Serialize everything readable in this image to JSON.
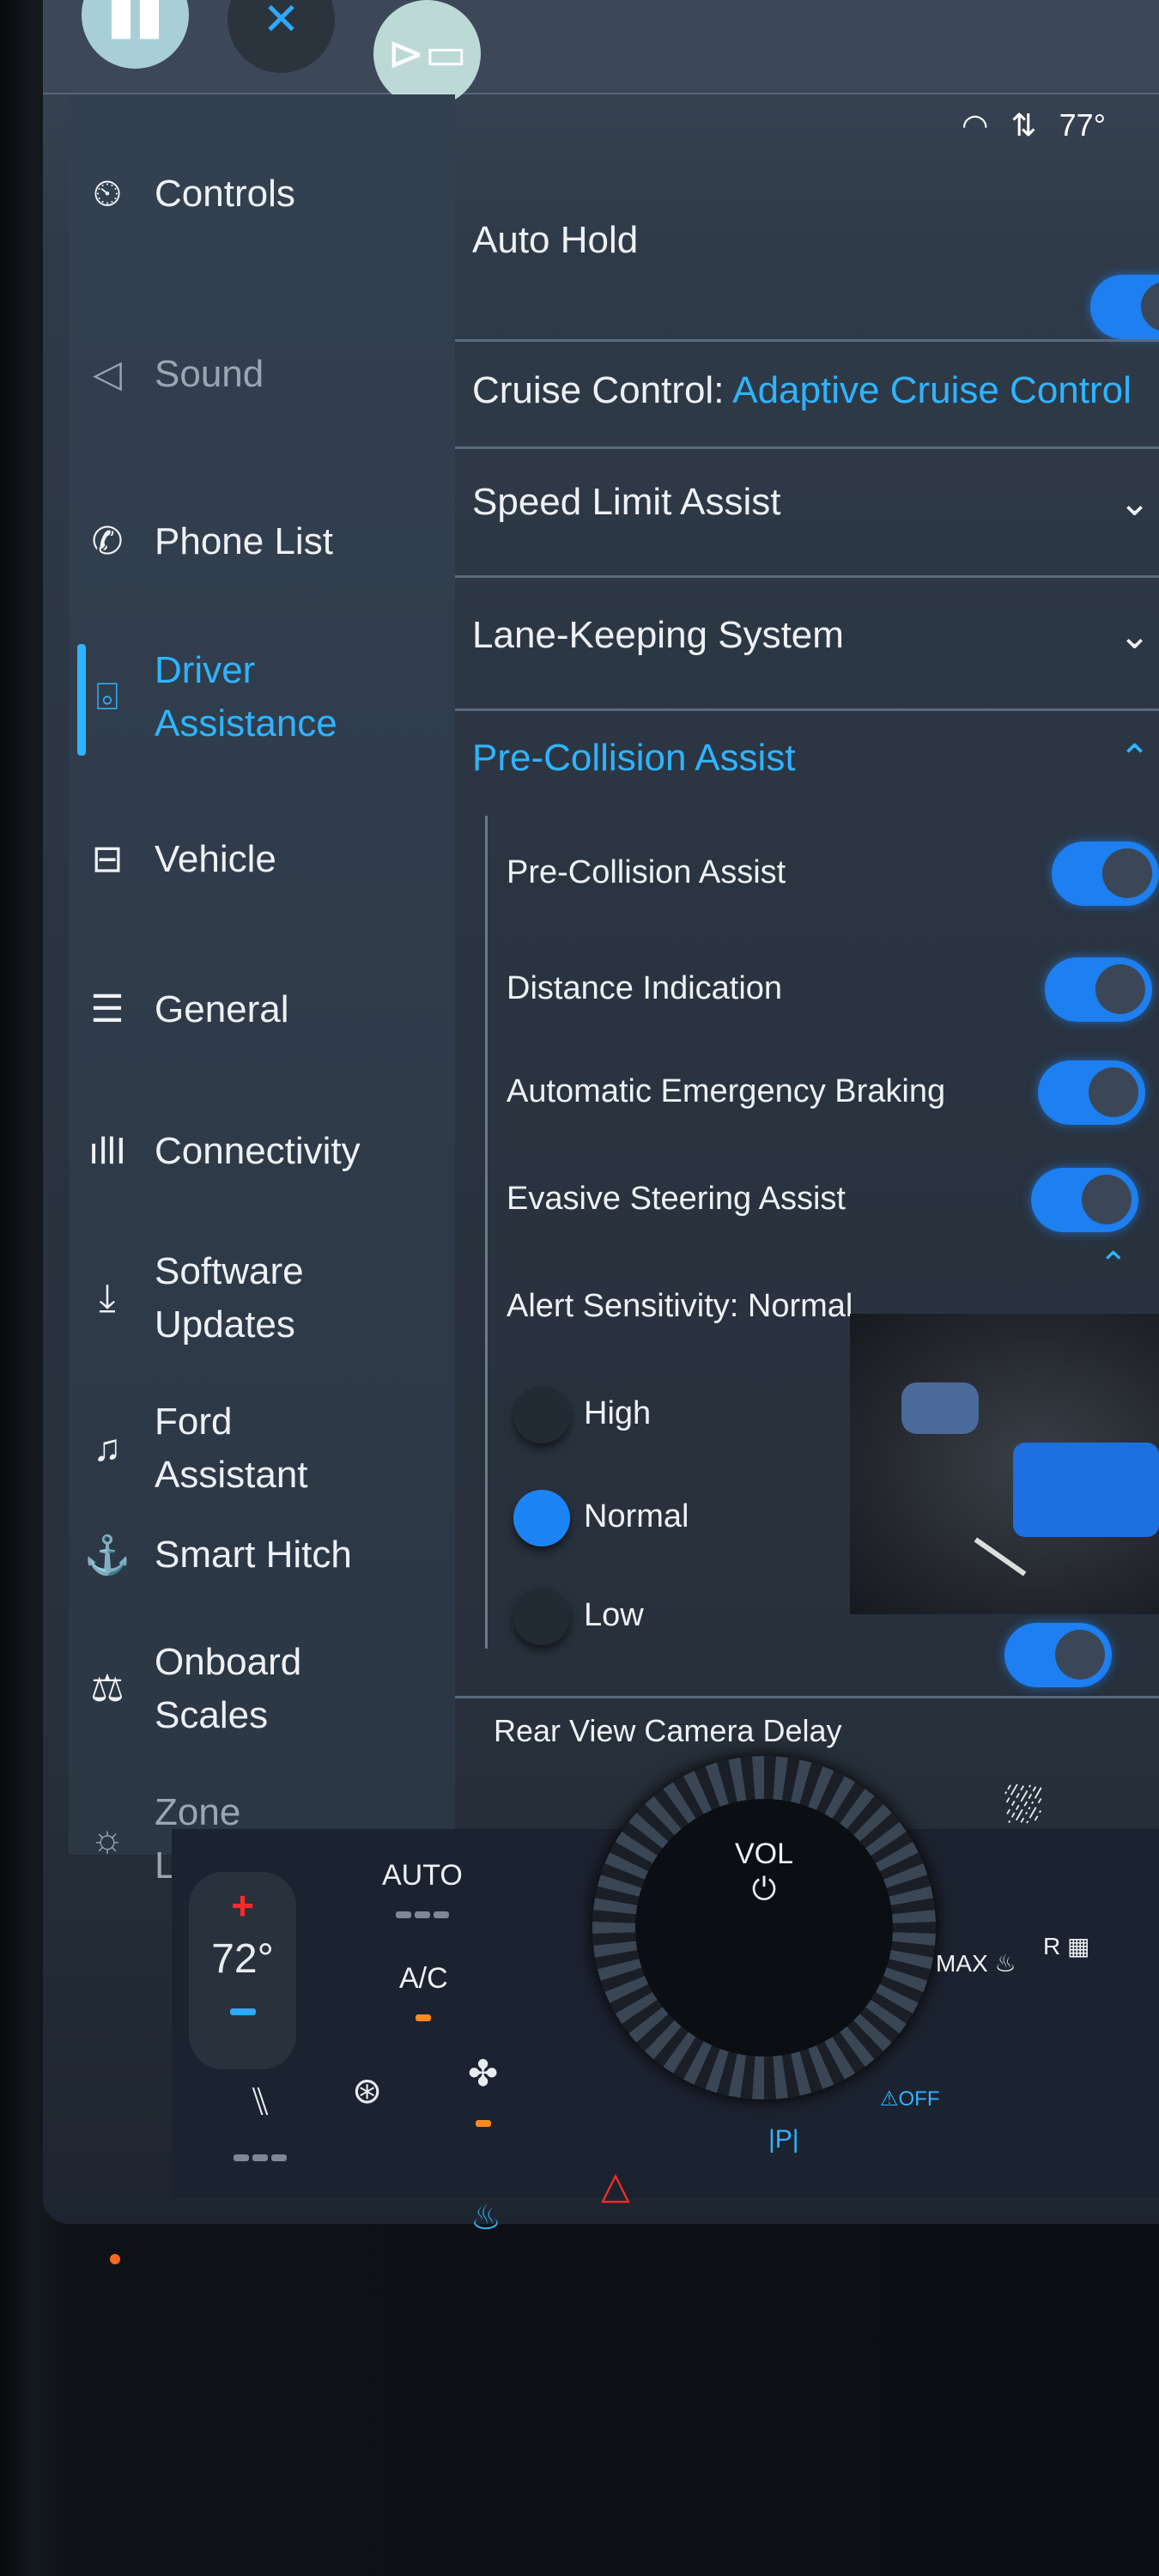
{
  "status": {
    "temperature": "77°",
    "icons": [
      "wifi-icon",
      "data-arrows-icon"
    ]
  },
  "topbar": {
    "buttons": [
      "home-icon",
      "close-icon",
      "camera-icon"
    ],
    "close_glyph": "✕"
  },
  "sidebar": {
    "items": [
      {
        "label": "Controls",
        "icon": "controls-icon",
        "glyph": "⏲"
      },
      {
        "label": "Sound",
        "icon": "speaker-icon",
        "glyph": "◁"
      },
      {
        "label": "Phone List",
        "icon": "phone-icon",
        "glyph": "✆"
      },
      {
        "label": "Driver Assistance",
        "icon": "driver-assist-icon",
        "glyph": "⌻",
        "active": true
      },
      {
        "label": "Vehicle",
        "icon": "vehicle-icon",
        "glyph": "⊟"
      },
      {
        "label": "General",
        "icon": "sliders-icon",
        "glyph": "☰"
      },
      {
        "label": "Connectivity",
        "icon": "signal-icon",
        "glyph": "ıllI"
      },
      {
        "label": "Software Updates",
        "icon": "download-icon",
        "glyph": "⤓"
      },
      {
        "label": "Ford Assistant",
        "icon": "assistant-icon",
        "glyph": "♫"
      },
      {
        "label": "Smart Hitch",
        "icon": "hitch-icon",
        "glyph": "⚓"
      },
      {
        "label": "Onboard Scales",
        "icon": "scales-icon",
        "glyph": "⚖"
      },
      {
        "label": "Zone Lighting",
        "icon": "zone-lighting-icon",
        "glyph": "☼"
      }
    ]
  },
  "main": {
    "auto_hold": {
      "label": "Auto Hold",
      "on": true
    },
    "cruise": {
      "label": "Cruise Control:",
      "value": "Adaptive Cruise Control"
    },
    "speed_limit": {
      "label": "Speed Limit Assist"
    },
    "lane_keeping": {
      "label": "Lane-Keeping System"
    },
    "pre_collision": {
      "header": "Pre-Collision Assist",
      "toggles": [
        {
          "label": "Pre-Collision Assist",
          "on": true
        },
        {
          "label": "Distance Indication",
          "on": true
        },
        {
          "label": "Automatic Emergency Braking",
          "on": true
        },
        {
          "label": "Evasive Steering Assist",
          "on": true
        }
      ],
      "alert_label": "Alert Sensitivity:",
      "alert_value": "Normal",
      "options": [
        {
          "label": "High",
          "selected": false
        },
        {
          "label": "Normal",
          "selected": true
        },
        {
          "label": "Low",
          "selected": false
        }
      ]
    },
    "rear_camera": {
      "label": "Rear View Camera Delay",
      "on": true
    }
  },
  "climate": {
    "temperature": "72°",
    "plus": "+",
    "auto": "AUTO",
    "ac": "A/C",
    "vol": "VOL",
    "max": "MAX",
    "rear": "R",
    "p": "|P|",
    "off": "OFF"
  },
  "colors": {
    "accent": "#2fb4ff",
    "toggle": "#1d7ff0",
    "hazard": "#ff2a2a",
    "indicator": "#ff8a1f"
  }
}
